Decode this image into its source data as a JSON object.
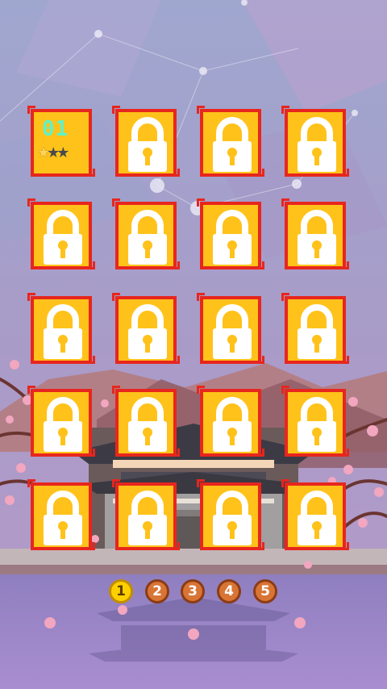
{
  "levels": [
    {
      "label": "01",
      "locked": false,
      "stars": [
        true,
        false,
        false
      ]
    },
    {
      "locked": true
    },
    {
      "locked": true
    },
    {
      "locked": true
    },
    {
      "locked": true
    },
    {
      "locked": true
    },
    {
      "locked": true
    },
    {
      "locked": true
    },
    {
      "locked": true
    },
    {
      "locked": true
    },
    {
      "locked": true
    },
    {
      "locked": true
    },
    {
      "locked": true
    },
    {
      "locked": true
    },
    {
      "locked": true
    },
    {
      "locked": true
    },
    {
      "locked": true
    },
    {
      "locked": true
    },
    {
      "locked": true
    },
    {
      "locked": true
    }
  ],
  "pages": [
    "1",
    "2",
    "3",
    "4",
    "5"
  ],
  "current_page": "1",
  "colors": {
    "tile_fill": "#ffc21a",
    "tile_border": "#e7261d",
    "active_page": "#ffd000",
    "inactive_page": "#d87535"
  }
}
